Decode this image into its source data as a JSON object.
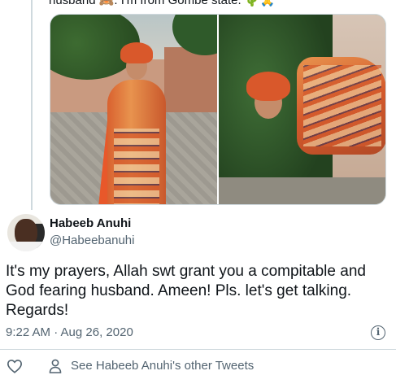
{
  "quoted_tweet": {
    "text_fragment": "husband 🙈. I'm from Gombe state. 🌵🙏"
  },
  "reply": {
    "author_name": "Habeeb Anuhi",
    "author_handle": "@Habeebanuhi",
    "text": "It's my prayers, Allah swt grant you a compitable and God fearing husband. Ameen! Pls. let's get talking. Regards!",
    "timestamp": "9:22 AM · Aug 26, 2020"
  },
  "actions": {
    "like_icon": "heart-outline-icon",
    "profile_icon": "person-outline-icon",
    "other_tweets_label": "See Habeeb Anuhi's other Tweets",
    "info_icon": "info-icon"
  },
  "colors": {
    "text_primary": "#0f1419",
    "text_secondary": "#536471",
    "border": "#cfd9de"
  }
}
